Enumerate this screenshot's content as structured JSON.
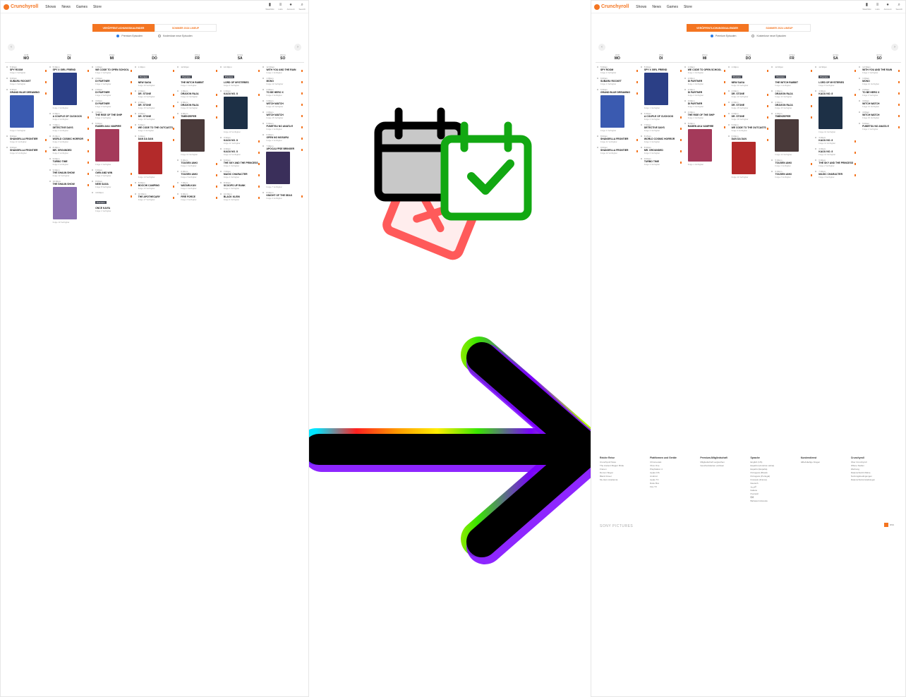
{
  "brand": {
    "name": "Crunchyroll",
    "accent": "#f47521"
  },
  "nav": [
    "Shows",
    "News",
    "Games",
    "Store"
  ],
  "top_icons": [
    {
      "icon": "bookmark-icon",
      "label": "Watchlist"
    },
    {
      "icon": "list-icon",
      "label": "Lists"
    },
    {
      "icon": "user-icon",
      "label": "Account"
    },
    {
      "icon": "search-icon",
      "label": "Search"
    }
  ],
  "toggle": {
    "active": "Veröffentlichungskalender",
    "inactive": "Sommer 2024 Lineup"
  },
  "radio": {
    "premium": "Premium Episoden",
    "free": "Kostenlose neue Episoden"
  },
  "days": [
    {
      "name": "MO",
      "date": "07/8"
    },
    {
      "name": "DI",
      "date": "07/9"
    },
    {
      "name": "MI",
      "date": "07/10"
    },
    {
      "name": "DO",
      "date": "07/11"
    },
    {
      "name": "FR",
      "date": "07/12"
    },
    {
      "name": "SA",
      "date": "07/13"
    },
    {
      "name": "SO",
      "date": "07/14"
    }
  ],
  "premiere_label": "Premiere",
  "schedule": [
    [
      {
        "time": "5:30pm",
        "title": "SPY ROOM",
        "meta": "Folge 2 Verfügbar"
      },
      {
        "time": "6:00pm",
        "title": "SUBARU ROCKET",
        "meta": "Folge 1 Verfügbar"
      },
      {
        "time": "6:30pm",
        "title": "GRAND BLUE DREAMING",
        "meta": "Folge 2 Verfügbar",
        "thumb": "#3a5ab0"
      },
      {
        "time": "8:00pm",
        "title": "SHANGRI-LA FRONTIER",
        "meta": "Folge 11 Verfügbar"
      },
      {
        "time": "9:00pm",
        "title": "SHANGRI-LA FRONTIER",
        "meta": "Folge 12 Verfügbar"
      }
    ],
    [
      {
        "time": "5:30pm",
        "title": "SPY X GIRL FRIEND",
        "meta": "Folge 1 Verfügbar",
        "thumb": "#2b3f86"
      },
      {
        "time": "6:30pm",
        "title": "A COUPLE OF CUCKOOS",
        "meta": "Folge 2 Verfügbar"
      },
      {
        "time": "7:00pm",
        "title": "DETECTIVE DAYS",
        "meta": "Folge 4 Verfügbar"
      },
      {
        "time": "8:15pm",
        "title": "WORLD COSMIC HORROR",
        "meta": "Folge 3 Verfügbar"
      },
      {
        "time": "8:30pm",
        "title": "MR. GROUNDED",
        "meta": "Folge 6 Verfügbar"
      },
      {
        "time": "9:00pm",
        "title": "TURBO TIME",
        "meta": "Folge 3 Verfügbar"
      },
      {
        "time": "9:30pm",
        "title": "THE SHAUN SHOW",
        "meta": "Folge 12 Verfügbar"
      },
      {
        "time": "10:00pm",
        "title": "THE SHAUN SHOW",
        "meta": "Folge 13 Verfügbar",
        "thumb": "#8a6fb0"
      }
    ],
    [
      {
        "time": "1:00am",
        "title": "WE CODE TO OPEN SCHOOL",
        "meta": "Folge 1 Verfügbar"
      },
      {
        "time": "2:00pm",
        "title": "DI PARTNER",
        "meta": "Folge 1 Verfügbar"
      },
      {
        "time": "2:30pm",
        "title": "DI PARTNER",
        "meta": "Folge 2 Verfügbar"
      },
      {
        "time": "3:00pm",
        "title": "DI PARTNER",
        "meta": "Folge 3 Verfügbar"
      },
      {
        "time": "4:00pm",
        "title": "THE RISE OF THE SHIP",
        "meta": "Folge 4 Verfügbar"
      },
      {
        "time": "5:00pm",
        "title": "RAMEN AKA VAMPIRE",
        "meta": "Folge 1 Verfügbar",
        "thumb": "#a43a5a"
      },
      {
        "time": "6:30pm",
        "title": "OWN AND WIN",
        "meta": "Folge 2 Verfügbar"
      },
      {
        "time": "8:00pm",
        "title": "NEW SAGA",
        "meta": "Folge 8 Verfügbar"
      },
      {
        "time": "10:00pm",
        "title": "ONCE KAIYA",
        "meta": "Folge 1 Verfügbar",
        "premiere": true
      }
    ],
    [
      {
        "time": "1:30pm",
        "title": "NEW SAGA",
        "meta": "Folge 10 Verfügbar",
        "premiere": true
      },
      {
        "time": "2:00pm",
        "title": "DR. STONE",
        "meta": "Folge 14 Verfügbar"
      },
      {
        "time": "2:30pm",
        "title": "DR. STONE",
        "meta": "Folge 15 Verfügbar"
      },
      {
        "time": "3:00pm",
        "title": "DR. STONE",
        "meta": "Folge 16 Verfügbar"
      },
      {
        "time": "5:00pm",
        "title": "WE CODE TO THE OUTCASTS",
        "meta": "Folge 3 Verfügbar"
      },
      {
        "time": "6:00pm",
        "title": "DAN DA DAN",
        "meta": "Folge 14 Verfügbar",
        "thumb": "#b32a2a"
      },
      {
        "time": "8:00pm",
        "title": "BOCCHI CAMPING",
        "meta": "Folge 13 Verfügbar"
      },
      {
        "time": "10:00pm",
        "title": "THE APOTHECARY",
        "meta": "Folge 17 Verfügbar"
      }
    ],
    [
      {
        "time": "12:00pm",
        "title": "THE WITCH RABBIT",
        "meta": "Folge 1 Verfügbar",
        "premiere": true
      },
      {
        "time": "1:00pm",
        "title": "DRAGON RAJA",
        "meta": "Folge 14 Verfügbar"
      },
      {
        "time": "2:00pm",
        "title": "DRAGON RAJA",
        "meta": "Folge 15 Verfügbar"
      },
      {
        "time": "3:00pm",
        "title": "TIMEKEEPER",
        "meta": "Folge 13 Verfügbar",
        "thumb": "#4a3a3a"
      },
      {
        "time": "5:30pm",
        "title": "TOUGEN ANKI",
        "meta": "Folge 1 Verfügbar"
      },
      {
        "time": "6:30pm",
        "title": "TOUGEN ANKI",
        "meta": "Folge 2 Verfügbar"
      },
      {
        "time": "7:30pm",
        "title": "WATARI-KUN",
        "meta": "Folge 1 Verfügbar"
      },
      {
        "time": "9:30pm",
        "title": "FIRE FORCE",
        "meta": "Folge 3 Verfügbar"
      }
    ],
    [
      {
        "time": "12:30pm",
        "title": "LORD OF MYSTERIES",
        "meta": "Folge 6 Verfügbar",
        "premiere": true
      },
      {
        "time": "1:00pm",
        "title": "KAIJU NO. 8",
        "meta": "Folge 10 Verfügbar",
        "thumb": "#1d3046"
      },
      {
        "time": "3:30pm",
        "title": "KAIJU NO. 8",
        "meta": "Folge 11 Verfügbar"
      },
      {
        "time": "4:30pm",
        "title": "KAIJU NO. 8",
        "meta": "Folge 12 Verfügbar"
      },
      {
        "time": "6:00pm",
        "title": "THE SKY AND THE PRINCESS",
        "meta": "Folge 2 Verfügbar"
      },
      {
        "time": "7:00pm",
        "title": "MAGIC CHARACTER",
        "meta": "Folge 4 Verfügbar"
      },
      {
        "time": "8:30pm",
        "title": "SCOOPS UP RANK",
        "meta": "Folge 1 Verfügbar"
      },
      {
        "time": "10:00pm",
        "title": "BLACK KLEIN",
        "meta": "Folge 9 Verfügbar"
      }
    ],
    [
      {
        "time": "12:30am",
        "title": "WITH YOU AND THE RAIN",
        "meta": "Folge 1 Verfügbar"
      },
      {
        "time": "1:00am",
        "title": "MONO",
        "meta": "Folge 12 Verfügbar"
      },
      {
        "time": "2:00am",
        "title": "TO BE HERO X",
        "meta": "Folge 2 Verfügbar"
      },
      {
        "time": "3:00am",
        "title": "WITCH WATCH",
        "meta": "Folge 14 Verfügbar"
      },
      {
        "time": "4:00am",
        "title": "WITCH WATCH",
        "meta": "Folge 15 Verfügbar"
      },
      {
        "time": "5:00am",
        "title": "FUMETSU NO ANATA E",
        "meta": "Folge 1 Verfügbar"
      },
      {
        "time": "6:00am",
        "title": "OPEN NO MOSURU",
        "meta": "Folge 4 Verfügbar"
      },
      {
        "time": "7:00pm",
        "title": "APOCALYPSE BRINGER",
        "meta": "Folge 7 Verfügbar",
        "thumb": "#3a2f5a"
      },
      {
        "time": "8:30pm",
        "title": "KNIGHT OF THE SEAS",
        "meta": "Folge 3 Verfügbar"
      }
    ]
  ],
  "footer": {
    "columns": [
      {
        "head": "Reiche Reise",
        "links": [
          "Crunchyroll Store",
          "The Ancient Magus' Bride",
          "Frieren",
          "Demon Slayer",
          "Black Clover",
          "My Hero Academia"
        ]
      },
      {
        "head": "Plattformen und Geräte",
        "links": [
          "Chromecast",
          "Xbox One",
          "PlayStation 4",
          "Apple iOS",
          "Android",
          "Apple TV",
          "Roku Box",
          "Fire TV"
        ]
      },
      {
        "head": "Premium-Mitgliedschaft",
        "links": [
          "Mitgliedschaft vergleichen",
          "Geschenkkarten einlösen"
        ]
      },
      {
        "head": "Sprache",
        "links": [
          "English (US)",
          "Español (América Latina)",
          "Español (España)",
          "Português (Brasil)",
          "Português (Portugal)",
          "Français (France)",
          "Deutsch",
          "العربية",
          "Italiano",
          "Русский",
          "हिंदी",
          "Bahasa Indonesia"
        ]
      },
      {
        "head": "Kundendienst",
        "links": [
          "Hilfe/Häufige Fragen"
        ]
      },
      {
        "head": "Crunchyroll",
        "links": [
          "Über Crunchyroll",
          "Offene Stellen",
          "Werbung",
          "Datenschutzrichtlinie",
          "Nutzungsbedingungen",
          "Datenschutzeinstellungen"
        ]
      }
    ],
    "sony": "SONY PICTURES",
    "rss": "RSS"
  }
}
